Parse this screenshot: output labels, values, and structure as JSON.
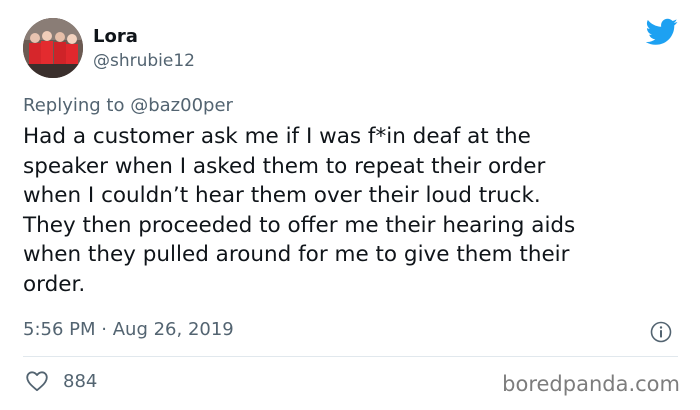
{
  "tweet": {
    "author": {
      "display_name": "Lora",
      "handle": "@shrubie12"
    },
    "reply": {
      "prefix": "Replying to",
      "mention": "@baz00per"
    },
    "text": "Had a customer ask me if I was f*in deaf at the\nspeaker when I asked them to repeat their order\nwhen I couldn’t hear them over their loud truck.\nThey then proceeded to offer me their hearing aids\nwhen they pulled around for me to give them their\norder.",
    "time": "5:56 PM",
    "separator": "·",
    "date": "Aug 26, 2019",
    "like_count": "884"
  },
  "icons": {
    "brand": "twitter-bird-icon",
    "info": "info-icon",
    "like": "heart-icon"
  },
  "colors": {
    "brand_blue": "#1da1f2",
    "secondary_text": "#536471"
  },
  "watermark": "boredpanda.com"
}
